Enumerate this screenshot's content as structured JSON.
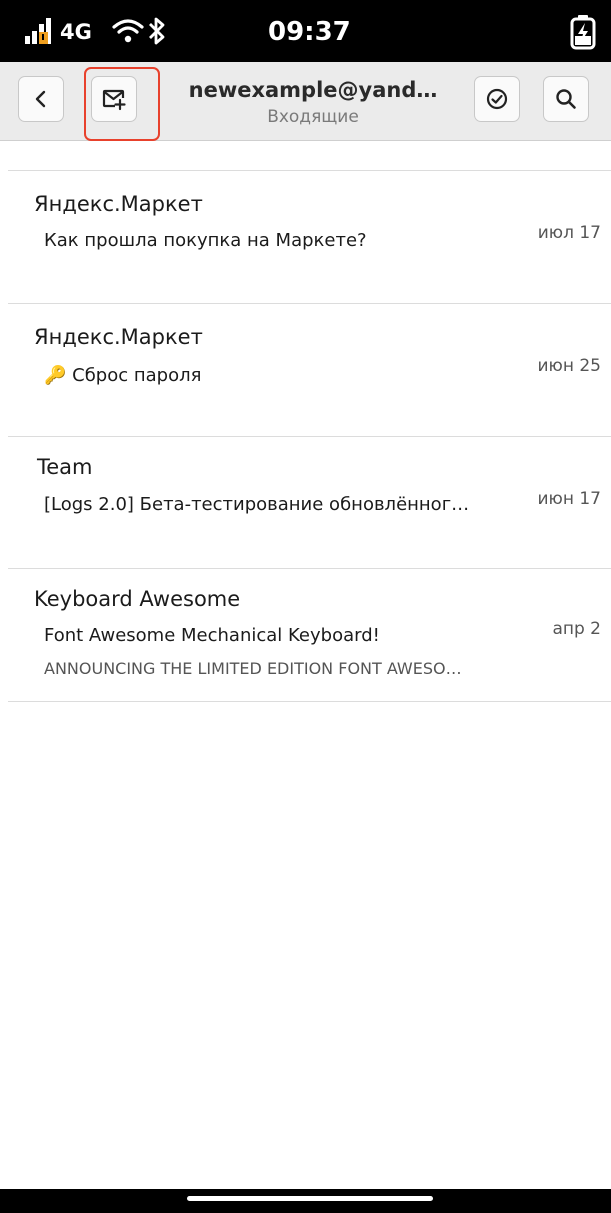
{
  "status_bar": {
    "network": "4G",
    "time": "09:37",
    "icons": [
      "signal-icon",
      "wifi-icon",
      "bluetooth-icon",
      "battery-charging-icon"
    ]
  },
  "header": {
    "title": "newexample@yand…",
    "subtitle": "Входящие",
    "buttons": [
      "back-icon",
      "compose-icon",
      "select-mode-icon",
      "search-icon"
    ],
    "highlight_color": "#e8412c"
  },
  "messages": [
    {
      "from": "Яндекс.Маркет",
      "subject": "Как прошла покупка на Маркете?",
      "date": "июл 17",
      "preview": ""
    },
    {
      "from": "Яндекс.Маркет",
      "subject": "🔑 Сброс пароля",
      "date": "июн 25",
      "preview": ""
    },
    {
      "from": "Team",
      "subject": "[Logs 2.0] Бета-тестирование обновлённог…",
      "date": "июн 17",
      "preview": ""
    },
    {
      "from": "Keyboard Awesome",
      "subject": "Font Awesome Mechanical Keyboard!",
      "date": "апр 2",
      "preview": "ANNOUNCING THE LIMITED EDITION FONT AWESO…"
    }
  ]
}
